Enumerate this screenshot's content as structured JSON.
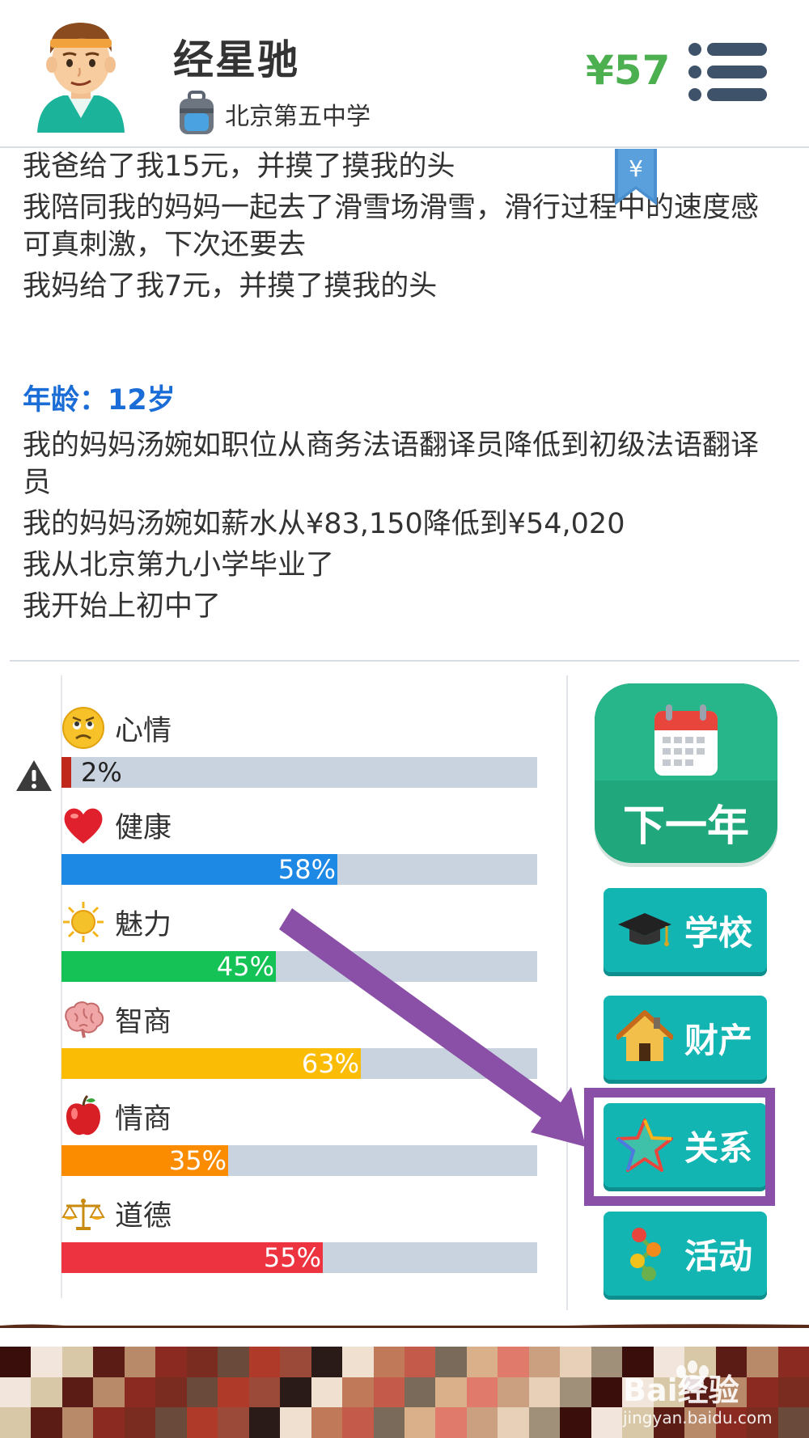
{
  "header": {
    "player_name": "经星驰",
    "school": "北京第五中学",
    "money": "¥57"
  },
  "bookmark": {
    "symbol": "¥"
  },
  "log": {
    "lines_before": [
      "我爸给了我15元，并摸了摸我的头",
      "我陪同我的妈妈一起去了滑雪场滑雪，滑行过程中的速度感可真刺激，下次还要去",
      "我妈给了我7元，并摸了摸我的头"
    ],
    "age_header": "年龄：12岁",
    "lines_after": [
      "我的妈妈汤婉如职位从商务法语翻译员降低到初级法语翻译员",
      "我的妈妈汤婉如薪水从¥83,150降低到¥54,020",
      "我从北京第九小学毕业了",
      "我开始上初中了"
    ]
  },
  "stats": [
    {
      "label": "心情",
      "icon": "sad-face-icon",
      "value": 2,
      "text": "2%",
      "color": "#c0281c"
    },
    {
      "label": "健康",
      "icon": "heart-icon",
      "value": 58,
      "text": "58%",
      "color": "#1e88e5"
    },
    {
      "label": "魅力",
      "icon": "sun-icon",
      "value": 45,
      "text": "45%",
      "color": "#14c255"
    },
    {
      "label": "智商",
      "icon": "brain-icon",
      "value": 63,
      "text": "63%",
      "color": "#fbbc05"
    },
    {
      "label": "情商",
      "icon": "apple-icon",
      "value": 35,
      "text": "35%",
      "color": "#fb8c00"
    },
    {
      "label": "道德",
      "icon": "scales-icon",
      "value": 55,
      "text": "55%",
      "color": "#ee3340"
    }
  ],
  "buttons": {
    "next_year": "下一年",
    "school": "学校",
    "property": "财产",
    "relations": "关系",
    "activities": "活动"
  },
  "colors": {
    "money": "#4caf50",
    "age_header": "#1a6cd6",
    "next_year_button": "#21a77c",
    "menu_button": "#13b5b3",
    "highlight": "#8a4fa6",
    "bar_track": "#c9d3df"
  },
  "watermark": {
    "brand": "Bai经验",
    "url": "jingyan.baidu.com"
  }
}
